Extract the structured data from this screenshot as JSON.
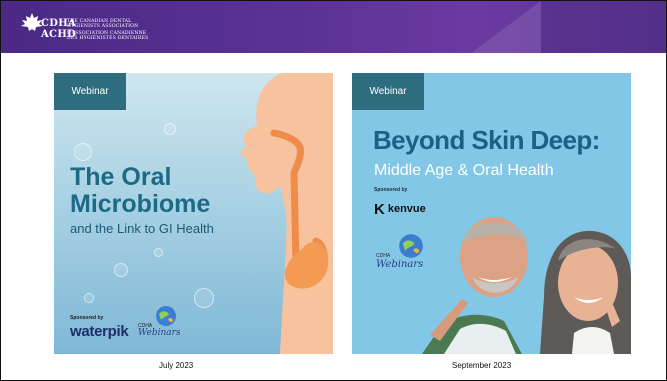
{
  "header": {
    "logo_abbr_en": "CDHA",
    "logo_abbr_fr": "ACHD",
    "org_name_en_1": "THE CANADIAN DENTAL",
    "org_name_en_2": "HYGIENISTS ASSOCIATION",
    "org_name_fr_1": "L'ASSOCIATION CANADIENNE",
    "org_name_fr_2": "DES HYGIÉNISTES DENTAIRES"
  },
  "cards": [
    {
      "tag": "Webinar",
      "title_line1": "The Oral",
      "title_line2": "Microbiome",
      "subtitle": "and the Link to GI Health",
      "sponsored_label": "Sponsored by",
      "sponsor": "waterpik",
      "webinars_logo_small": "CDHA",
      "webinars_logo_script": "Webinars",
      "caption": "July 2023"
    },
    {
      "tag": "Webinar",
      "title": "Beyond Skin Deep:",
      "subtitle": "Middle Age & Oral Health",
      "sponsored_label": "Sponsored by",
      "sponsor_mark": "K",
      "sponsor": "kenvue",
      "webinars_logo_small": "CDHA",
      "webinars_logo_script": "Webinars",
      "caption": "September 2023"
    }
  ],
  "colors": {
    "header_purple": "#5b3294",
    "tag_teal": "#2e6d80",
    "card2_sky": "#83c7e6",
    "title_blue": "#1d6a86"
  }
}
